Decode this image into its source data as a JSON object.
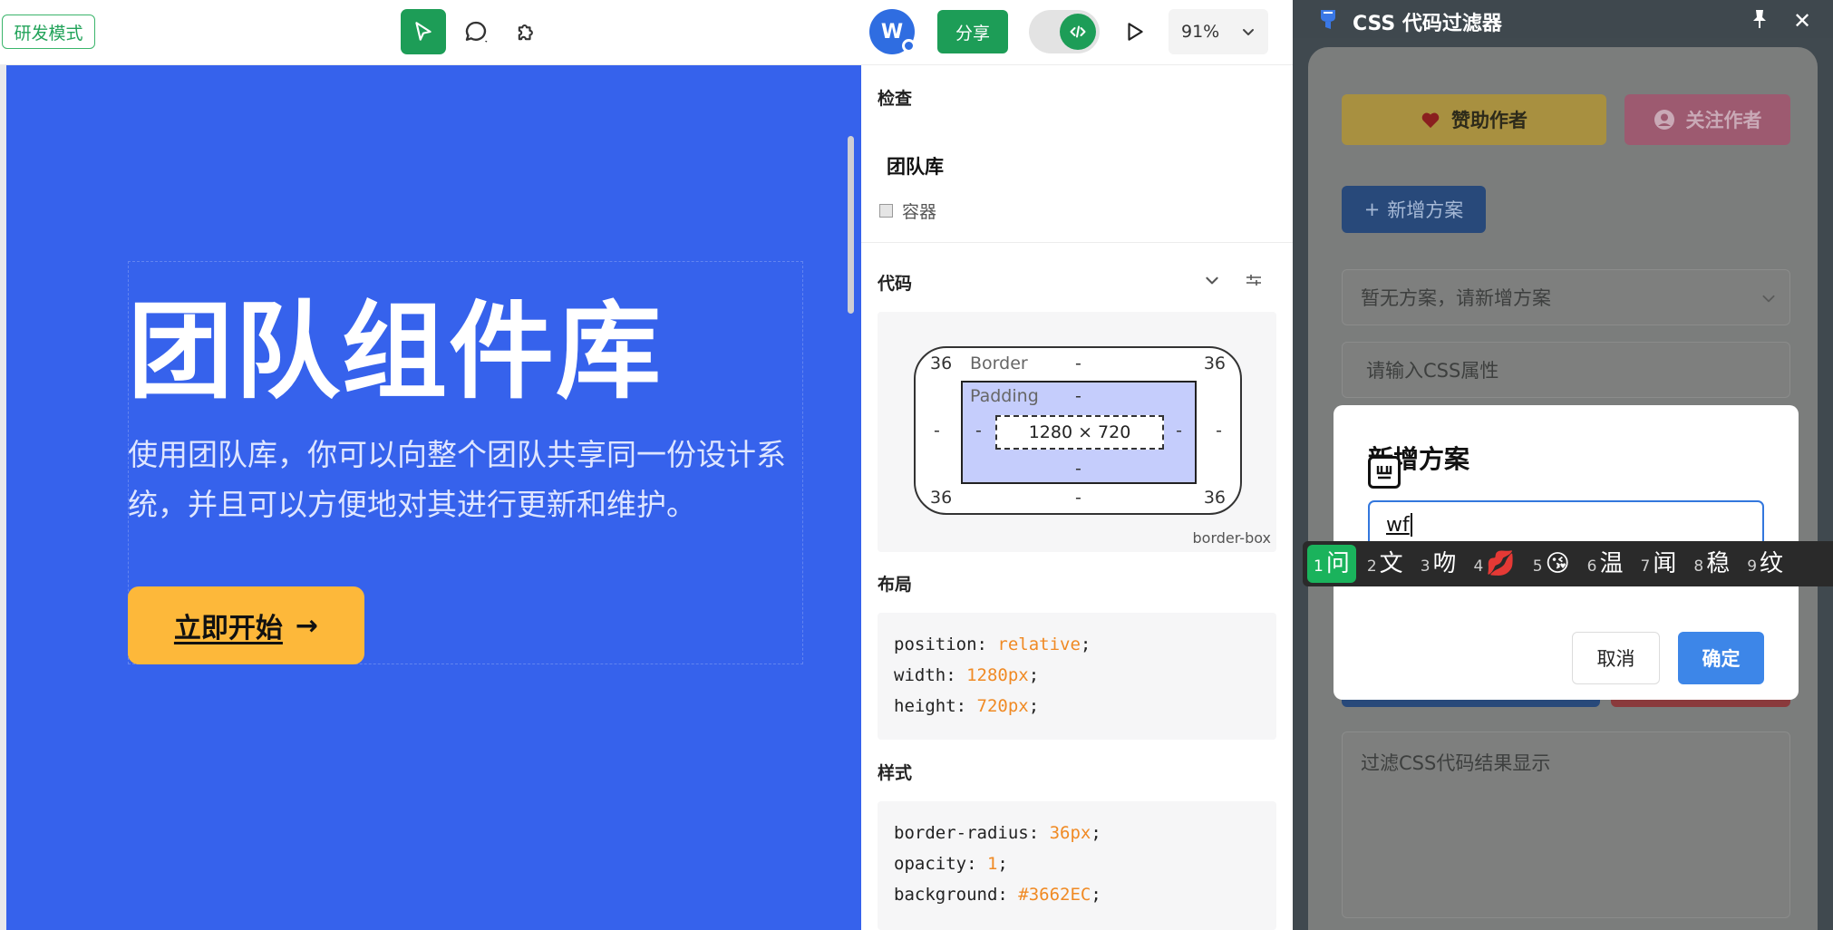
{
  "toolbar": {
    "mode_badge": "研发模式",
    "avatar_initial": "W",
    "share_label": "分享",
    "zoom": "91%"
  },
  "canvas": {
    "hero_title": "团队组件库",
    "hero_desc": "使用团队库，你可以向整个团队共享同一份设计系统，并且可以方便地对其进行更新和维护。",
    "cta_label": "立即开始",
    "cta_arrow": "→",
    "frame_color": "#3662EC",
    "cta_color": "#FDB83A"
  },
  "inspector": {
    "inspect_title": "检查",
    "component_name": "团队库",
    "component_type": "容器",
    "code_title": "代码",
    "box_model": {
      "border_label": "Border",
      "padding_label": "Padding",
      "radius_tl": "36",
      "radius_tr": "36",
      "radius_bl": "36",
      "radius_br": "36",
      "border_top": "-",
      "border_bottom": "-",
      "border_left": "-",
      "border_right": "-",
      "padding_top": "-",
      "padding_bottom": "-",
      "padding_left": "-",
      "padding_right": "-",
      "content_size": "1280 × 720",
      "box_sizing": "border-box"
    },
    "layout_title": "布局",
    "layout_code": [
      {
        "prop": "position",
        "value": "relative"
      },
      {
        "prop": "width",
        "value": "1280px"
      },
      {
        "prop": "height",
        "value": "720px"
      }
    ],
    "style_title": "样式",
    "style_code": [
      {
        "prop": "border-radius",
        "value": "36px"
      },
      {
        "prop": "opacity",
        "value": "1"
      },
      {
        "prop": "background",
        "value": "#3662EC"
      }
    ]
  },
  "plugin": {
    "title": "CSS 代码过滤器",
    "close_glyph": "✕",
    "sponsor_label": "赞助作者",
    "follow_label": "关注作者",
    "new_plan_label": "新增方案",
    "new_plan_plus": "+",
    "plan_select_placeholder": "暂无方案，请新增方案",
    "css_input_placeholder": "请输入CSS属性",
    "result_placeholder": "过滤CSS代码结果显示"
  },
  "modal": {
    "title": "新增方案",
    "input_value": "wf",
    "cancel_label": "取消",
    "confirm_label": "确定"
  },
  "ime": {
    "candidates": [
      {
        "n": "1",
        "text": "问"
      },
      {
        "n": "2",
        "text": "文"
      },
      {
        "n": "3",
        "text": "吻"
      },
      {
        "n": "4",
        "text": "💋"
      },
      {
        "n": "5",
        "text": "😘"
      },
      {
        "n": "6",
        "text": "温"
      },
      {
        "n": "7",
        "text": "闻"
      },
      {
        "n": "8",
        "text": "稳"
      },
      {
        "n": "9",
        "text": "纹"
      }
    ]
  }
}
